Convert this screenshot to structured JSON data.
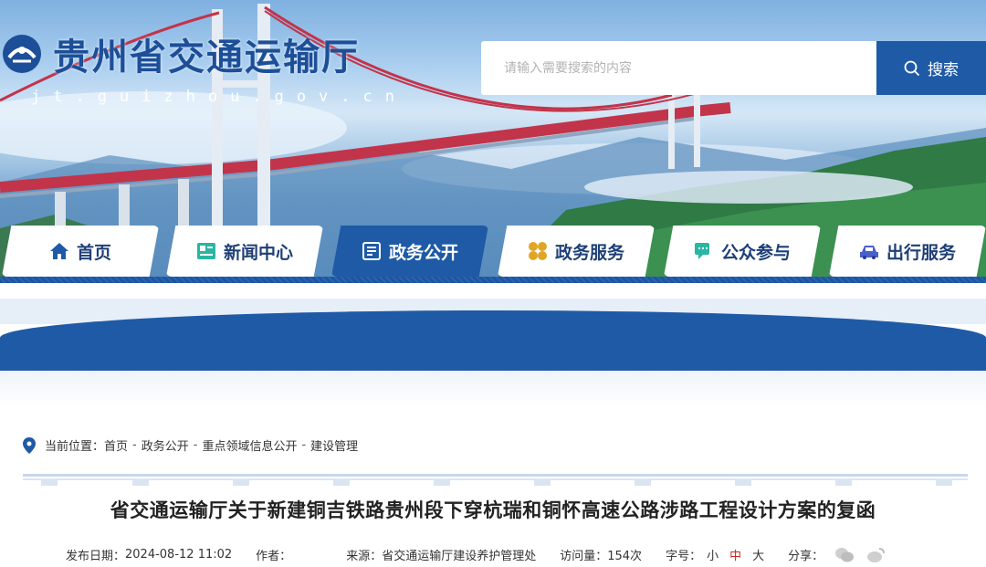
{
  "site": {
    "title": "贵州省交通运输厅",
    "domain": "jt.guizhou.gov.cn"
  },
  "search": {
    "placeholder": "请输入需要搜索的内容",
    "button_label": "搜索"
  },
  "nav": {
    "items": [
      {
        "label": "首页",
        "icon": "home-icon"
      },
      {
        "label": "新闻中心",
        "icon": "news-icon"
      },
      {
        "label": "政务公开",
        "icon": "document-icon",
        "active": true
      },
      {
        "label": "政务服务",
        "icon": "grid-icon"
      },
      {
        "label": "公众参与",
        "icon": "chat-icon"
      },
      {
        "label": "出行服务",
        "icon": "car-icon"
      }
    ]
  },
  "breadcrumb": {
    "prefix": "当前位置：",
    "items": [
      "首页",
      "政务公开",
      "重点领域信息公开",
      "建设管理"
    ],
    "separator": "-"
  },
  "article": {
    "title": "省交通运输厅关于新建铜吉铁路贵州段下穿杭瑞和铜怀高速公路涉路工程设计方案的复函",
    "meta": {
      "date_label": "发布日期：",
      "date": "2024-08-12 11:02",
      "author_label": "作者：",
      "author": "",
      "source_label": "来源：",
      "source": "省交通运输厅建设养护管理处",
      "views_label": "访问量：",
      "views": "154次",
      "fontsize_label": "字号：",
      "fontsize_small": "小",
      "fontsize_medium": "中",
      "fontsize_large": "大",
      "share_label": "分享："
    }
  },
  "colors": {
    "brand_blue": "#1f5aa6",
    "title_blue": "#1d4f98",
    "active_fontsize": "#d0251b"
  }
}
